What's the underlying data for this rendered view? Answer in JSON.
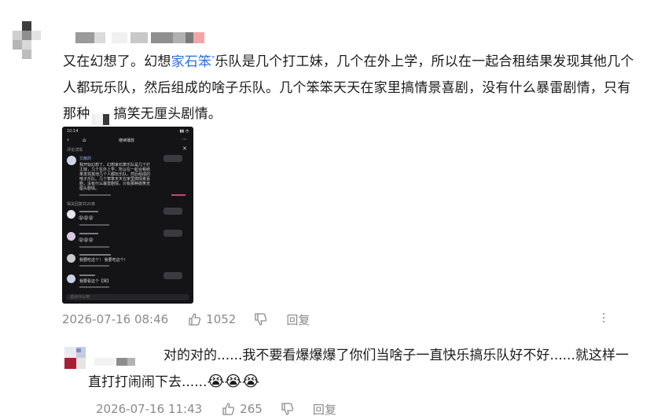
{
  "comment": {
    "text_before_link": "又在幻想了。幻想",
    "link_text": "家石笨",
    "link_marker": "ᐤ",
    "text_after_link": "乐队是几个打工妹，几个在外上学，所以在一起合租结果发现其他几个人都玩乐队，然后组成的啥子乐队。几个笨笨天天在家里搞情景喜剧，没有什么暴雷剧情，只有那种",
    "text_after_redaction": "搞笑无厘头剧情。",
    "timestamp": "2026-07-16 08:46",
    "like_count": "1052",
    "reply_label": "回复"
  },
  "embedded_screenshot": {
    "status_time": "10:14",
    "header_title": "继续播放",
    "section_label": "评论详情",
    "username": "文献的",
    "body_lines": [
      "我开始幻想了。幻想家石笨乐队是几个打",
      "工妹，几个在外上学，所以在一起合租结",
      "果发现其他几个人都玩乐队，然后组成的",
      "啥子乐队。几个笨笨天天在家里搞情景喜",
      "剧，没有什么暴雷剧情，只有那种搞笑无",
      "厘头剧情。"
    ],
    "replies_header": "相关回复共20条",
    "replies": [
      {
        "emoji": "😵😵😵"
      },
      {
        "emoji": "😵😵😵"
      },
      {
        "text": "我要吃这个！ 我要吃这个！"
      },
      {
        "text": "我要看这个【哭】"
      }
    ],
    "input_placeholder": "说点什么吧"
  },
  "reply": {
    "text": "对的对的......我不要看爆爆爆了你们当啥子一直快乐搞乐队好不好......就这样一直打打闹闹下去......",
    "emoji": "😭😭😭",
    "timestamp": "2026-07-16 11:43",
    "like_count": "265",
    "reply_label": "回复"
  },
  "colors": {
    "link": "#2f6fd6",
    "meta_text": "#8a8a8a",
    "body_text": "#1b1b1b"
  },
  "icons": [
    "thumb-up-icon",
    "thumb-down-icon",
    "more-vertical-icon",
    "search-marker-icon"
  ]
}
